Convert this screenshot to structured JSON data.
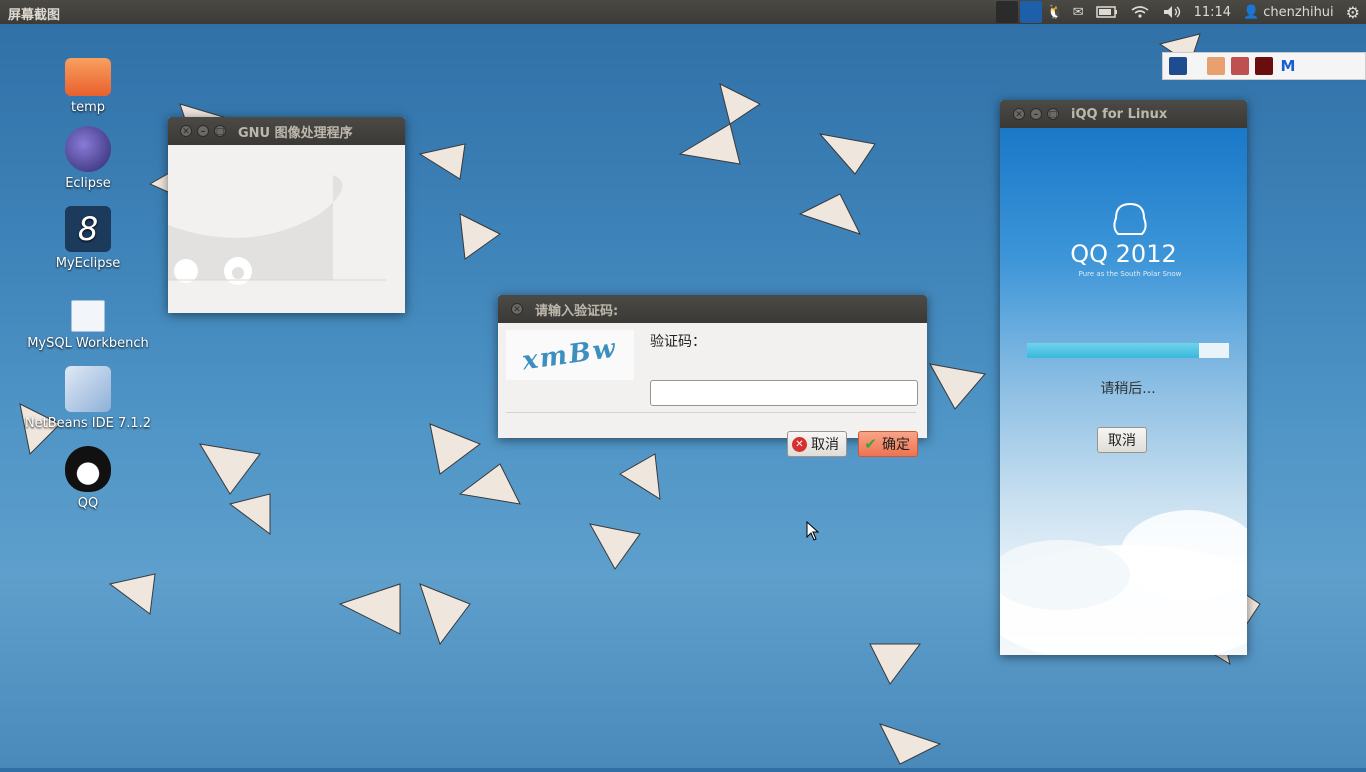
{
  "panel": {
    "app_title": "屏幕截图",
    "clock": "11:14",
    "user": "chenzhihui",
    "mail_icon": "mail-icon",
    "battery_icon": "battery-icon",
    "wifi_icon": "wifi-icon",
    "volume_icon": "volume-icon",
    "user_icon": "user-icon",
    "settings_icon": "gear-icon"
  },
  "desktop_icons": [
    {
      "label": "temp",
      "icon": "folder-icon"
    },
    {
      "label": "Eclipse",
      "icon": "eclipse-icon"
    },
    {
      "label": "MyEclipse",
      "icon": "myeclipse-icon"
    },
    {
      "label": "MySQL Workbench",
      "icon": "mysql-workbench-icon"
    },
    {
      "label": "NetBeans IDE 7.1.2",
      "icon": "netbeans-icon"
    },
    {
      "label": "QQ",
      "icon": "qq-penguin-icon"
    }
  ],
  "gimp_window": {
    "title": "GNU 图像处理程序"
  },
  "captcha_dialog": {
    "title": "请输入验证码:",
    "captcha_text": "xmBw",
    "label": "验证码：",
    "input_value": "",
    "cancel_label": "取消",
    "ok_label": "确定"
  },
  "iqq_window": {
    "title": "iQQ for Linux",
    "logo_text": "QQ 2012",
    "slogan": "Pure as the South Polar Snow",
    "status": "请稍后...",
    "progress": 0.85,
    "cancel_label": "取消"
  },
  "colors": {
    "panel_bg": "#3c3b37",
    "accent_orange": "#f0775a",
    "progress_cyan": "#4fc3e0"
  }
}
